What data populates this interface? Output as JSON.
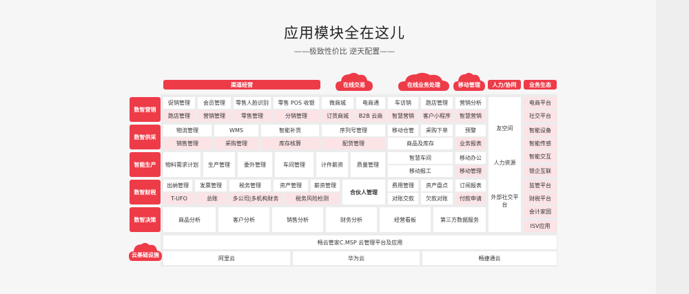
{
  "title": "应用模块全在这儿",
  "subtitle": "——极致性价比  逆天配置——",
  "headers": {
    "qudao": "渠道经营",
    "zaixian_jiaoyi": "在线交易",
    "zaixian_yewu": "在线业务处理",
    "yidong": "移动管理",
    "renli": "人力/协同",
    "yewu_shengtai": "业务生态"
  },
  "categories": {
    "yingxiao": "数智营销",
    "gongying": "数智供采",
    "shengchan": "智能生产",
    "caishui": "数智财税",
    "juece": "数智决策",
    "yun": "云基础设施"
  },
  "modules": {
    "r1a": [
      "促销管理",
      "会员管理",
      "零售人脸识别",
      "零售 POS 收银",
      "微商城",
      "电商通",
      "车访销",
      "跑店管理"
    ],
    "r1b": [
      "跑店管理",
      "营销管理",
      "零售管理",
      "分销管理",
      "订货商城",
      "B2B 云商",
      "智慧营销",
      "客户小程序"
    ],
    "r2a": [
      "物流管理",
      "WMS",
      "智能补货",
      "序列号管理",
      "移动仓管",
      "采购下单"
    ],
    "r2b": [
      "销售管理",
      "采购管理",
      "库存核算",
      "配货管理",
      "商品及库存"
    ],
    "r3": [
      "物料需求计划",
      "生产管理",
      "委外管理",
      "车间管理",
      "计件薪资",
      "质量管理",
      "智慧车间",
      "移动报工"
    ],
    "r4a": [
      "出纳管理",
      "发票管理",
      "税务管理",
      "资产管理",
      "薪资管理",
      "费用管理",
      "资产盘点"
    ],
    "r4b": [
      "T-UFO",
      "总账",
      "多公司|多机构财务",
      "税务风险检测",
      "对账交款",
      "欠款对账"
    ],
    "hehuoren": "合伙人管理",
    "r5": [
      "商品分析",
      "客户分析",
      "销售分析",
      "财务分析",
      "经营看板",
      "第三方数据服务"
    ],
    "yidong_col": [
      "营销分析",
      "智慧营销",
      "预警",
      "业务报表",
      "移动办公",
      "移动管理",
      "订阅报表",
      "付款申请"
    ],
    "renli_col": [
      "友空间",
      "人力资源",
      "外部社交平台"
    ],
    "shengtai_col": [
      "电商平台",
      "社交平台",
      "智能设备",
      "智能传感",
      "智能交互",
      "银企互联",
      "监管平台",
      "财税平台",
      "会计家园",
      "ISV应用"
    ],
    "infra_top": "畅云管家C.MSP 云管理平台及应用",
    "infra_bottom": [
      "阿里云",
      "华为云",
      "畅捷通云"
    ]
  },
  "colors": {
    "accent": "#ee3b48",
    "pink": "#fbe3e6",
    "white": "#ffffff",
    "panel": "#ececed"
  }
}
